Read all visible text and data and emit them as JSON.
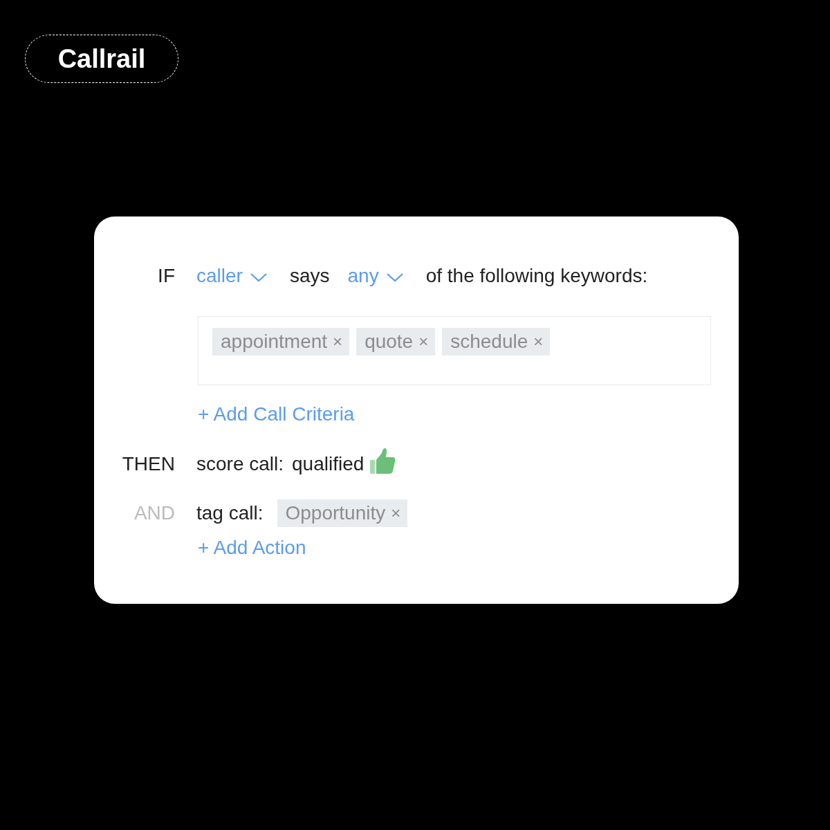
{
  "badge": "Callrail",
  "condition": {
    "label": "IF",
    "subject": "caller",
    "verb": "says",
    "quantifier": "any",
    "suffix": "of the following keywords:",
    "keywords": [
      {
        "text": "appointment",
        "remove": "×"
      },
      {
        "text": "quote",
        "remove": "×"
      },
      {
        "text": "schedule",
        "remove": "×"
      }
    ],
    "add_link": "+ Add Call Criteria"
  },
  "actions": [
    {
      "kind": "score",
      "label": "THEN",
      "muted": false,
      "action": "score call:",
      "value": "qualified"
    },
    {
      "kind": "tag",
      "label": "AND",
      "muted": true,
      "action": "tag call:",
      "tags": [
        {
          "text": "Opportunity",
          "remove": "×"
        }
      ]
    }
  ],
  "add_action": "+ Add Action"
}
